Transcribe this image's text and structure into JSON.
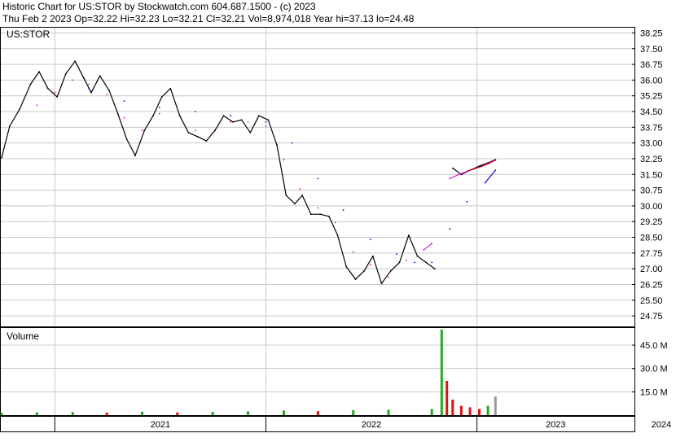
{
  "header": {
    "line1": "Historic Chart for US:STOR by Stockwatch.com 604.687.1500 - (c) 2023",
    "line2": "Thu Feb  2 2023  Op=32.22  Hi=32.23  Lo=32.21  Cl=32.21  Vol=8,974,018  Year hi=37.13  lo=24.48"
  },
  "colors": {
    "price": "#000000",
    "ma_short": "#dd00dd",
    "ma_long": "#0000cc",
    "ma_tail": "#cc0000",
    "vol_up": "#22aa22",
    "vol_down": "#dd1111",
    "vol_last": "#999999",
    "grid": "#c8c8c8"
  },
  "chart_data": [
    {
      "type": "line",
      "title": "US:STOR",
      "ylim": [
        24.25,
        38.5
      ],
      "y_ticks": [
        "38.25",
        "37.50",
        "36.75",
        "36.00",
        "35.25",
        "34.50",
        "33.75",
        "33.00",
        "32.25",
        "31.50",
        "30.75",
        "30.00",
        "29.25",
        "28.50",
        "27.75",
        "27.00",
        "26.25",
        "25.50",
        "24.75"
      ],
      "x_labels": [
        "2021",
        "2022",
        "2023",
        "2024"
      ],
      "grid": true,
      "series": [
        {
          "key": "price",
          "points": [
            [
              "2020-10-01",
              32.3
            ],
            [
              "2020-10-15",
              33.8
            ],
            [
              "2020-11-01",
              34.6
            ],
            [
              "2020-11-20",
              35.8
            ],
            [
              "2020-12-05",
              36.4
            ],
            [
              "2020-12-20",
              35.6
            ],
            [
              "2021-01-05",
              35.2
            ],
            [
              "2021-01-20",
              36.3
            ],
            [
              "2021-02-05",
              36.9
            ],
            [
              "2021-02-20",
              36.1
            ],
            [
              "2021-03-05",
              35.4
            ],
            [
              "2021-03-20",
              36.2
            ],
            [
              "2021-04-05",
              35.5
            ],
            [
              "2021-04-20",
              34.4
            ],
            [
              "2021-05-05",
              33.2
            ],
            [
              "2021-05-20",
              32.4
            ],
            [
              "2021-06-05",
              33.6
            ],
            [
              "2021-06-20",
              34.3
            ],
            [
              "2021-07-05",
              35.2
            ],
            [
              "2021-07-20",
              35.6
            ],
            [
              "2021-08-05",
              34.3
            ],
            [
              "2021-08-20",
              33.5
            ],
            [
              "2021-09-05",
              33.3
            ],
            [
              "2021-09-20",
              33.1
            ],
            [
              "2021-10-05",
              33.6
            ],
            [
              "2021-10-20",
              34.3
            ],
            [
              "2021-11-05",
              34.0
            ],
            [
              "2021-11-20",
              34.1
            ],
            [
              "2021-12-05",
              33.5
            ],
            [
              "2021-12-20",
              34.3
            ],
            [
              "2022-01-05",
              34.1
            ],
            [
              "2022-01-20",
              32.9
            ],
            [
              "2022-02-05",
              30.5
            ],
            [
              "2022-02-20",
              30.1
            ],
            [
              "2022-03-05",
              30.5
            ],
            [
              "2022-03-20",
              29.6
            ],
            [
              "2022-04-05",
              29.6
            ],
            [
              "2022-04-20",
              29.5
            ],
            [
              "2022-05-05",
              28.6
            ],
            [
              "2022-05-20",
              27.1
            ],
            [
              "2022-06-05",
              26.5
            ],
            [
              "2022-06-20",
              26.9
            ],
            [
              "2022-07-05",
              27.6
            ],
            [
              "2022-07-20",
              26.3
            ],
            [
              "2022-08-05",
              26.9
            ],
            [
              "2022-08-20",
              27.3
            ],
            [
              "2022-09-05",
              28.6
            ],
            [
              "2022-09-20",
              27.6
            ],
            [
              "2022-10-05",
              27.3
            ],
            [
              "2022-10-20",
              27.0
            ],
            [
              "2022-11-20",
              31.8
            ],
            [
              "2022-12-05",
              31.5
            ],
            [
              "2022-12-20",
              31.7
            ],
            [
              "2023-01-05",
              31.9
            ],
            [
              "2023-01-20",
              32.05
            ],
            [
              "2023-02-02",
              32.21
            ]
          ]
        },
        {
          "key": "ma_short",
          "points": [
            [
              "2020-12-01",
              34.8
            ],
            [
              "2021-01-01",
              35.4
            ],
            [
              "2021-02-01",
              36.0
            ],
            [
              "2021-03-01",
              35.8
            ],
            [
              "2021-04-01",
              35.3
            ],
            [
              "2021-05-01",
              34.2
            ],
            [
              "2021-06-01",
              33.6
            ],
            [
              "2021-07-01",
              34.4
            ],
            [
              "2021-08-01",
              34.6
            ],
            [
              "2021-09-01",
              33.6
            ],
            [
              "2021-10-01",
              33.5
            ],
            [
              "2021-11-01",
              34.0
            ],
            [
              "2021-12-01",
              34.0
            ],
            [
              "2022-01-01",
              33.8
            ],
            [
              "2022-02-01",
              32.2
            ],
            [
              "2022-03-01",
              30.8
            ],
            [
              "2022-04-01",
              29.9
            ],
            [
              "2022-05-01",
              29.2
            ],
            [
              "2022-06-01",
              27.8
            ],
            [
              "2022-07-01",
              27.2
            ],
            [
              "2022-08-01",
              26.6
            ],
            [
              "2022-09-01",
              27.4
            ],
            [
              "2022-10-01",
              27.9
            ],
            [
              "2022-10-15",
              28.2
            ],
            [
              "2022-11-15",
              31.3
            ],
            [
              "2022-12-01",
              31.5
            ],
            [
              "2022-12-20",
              31.7
            ],
            [
              "2023-01-10",
              31.9
            ],
            [
              "2023-02-02",
              32.2
            ]
          ]
        },
        {
          "key": "ma_long",
          "points": [
            [
              "2021-03-01",
              35.6
            ],
            [
              "2021-05-01",
              35.0
            ],
            [
              "2021-07-01",
              34.7
            ],
            [
              "2021-09-01",
              34.5
            ],
            [
              "2021-11-01",
              34.3
            ],
            [
              "2022-01-01",
              34.0
            ],
            [
              "2022-02-15",
              33.0
            ],
            [
              "2022-04-01",
              31.3
            ],
            [
              "2022-05-15",
              29.8
            ],
            [
              "2022-07-01",
              28.4
            ],
            [
              "2022-08-15",
              27.7
            ],
            [
              "2022-09-15",
              27.3
            ],
            [
              "2022-10-15",
              27.3
            ],
            [
              "2022-11-15",
              28.9
            ],
            [
              "2022-12-15",
              30.2
            ],
            [
              "2023-01-15",
              31.1
            ],
            [
              "2023-02-02",
              31.7
            ]
          ]
        },
        {
          "key": "ma_tail",
          "points": [
            [
              "2022-12-15",
              31.65
            ],
            [
              "2023-01-05",
              31.85
            ],
            [
              "2023-01-20",
              32.0
            ],
            [
              "2023-02-02",
              32.18
            ]
          ]
        }
      ]
    },
    {
      "type": "bar",
      "title": "Volume",
      "ylim": [
        0,
        56
      ],
      "y_ticks": [
        "45.0 M",
        "30.0 M",
        "15.0 M"
      ],
      "grid": true,
      "x": [
        "2020-10-01",
        "2020-12-01",
        "2021-02-01",
        "2021-04-01",
        "2021-06-01",
        "2021-08-01",
        "2021-10-01",
        "2021-12-01",
        "2022-02-01",
        "2022-04-01",
        "2022-06-01",
        "2022-08-01",
        "2022-10-15",
        "2022-11-01",
        "2022-11-10",
        "2022-11-20",
        "2022-12-05",
        "2022-12-20",
        "2023-01-05",
        "2023-01-20",
        "2023-02-02"
      ],
      "values": [
        1.5,
        1.8,
        2.0,
        1.6,
        2.2,
        1.8,
        2.1,
        2.4,
        3.0,
        2.5,
        3.2,
        3.5,
        4.0,
        55.0,
        22.0,
        10.0,
        6.0,
        5.0,
        4.0,
        6.0,
        12.0
      ]
    }
  ]
}
